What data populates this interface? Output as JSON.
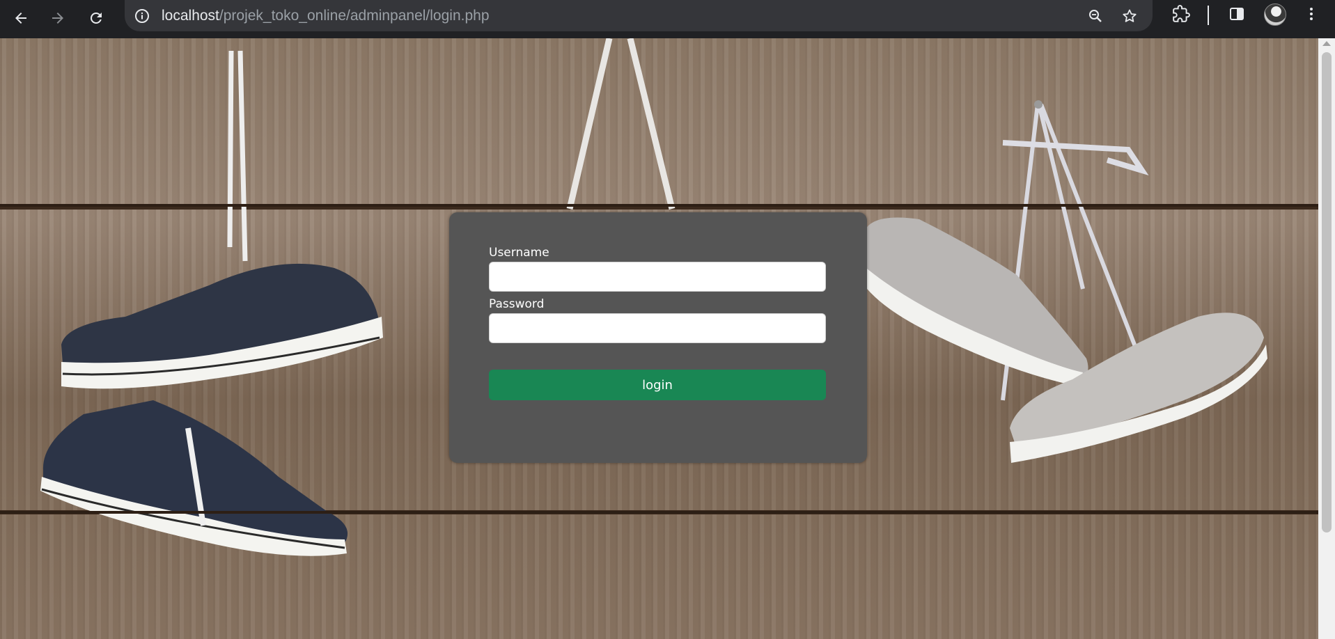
{
  "browser": {
    "url_host": "localhost",
    "url_path": "/projek_toko_online/adminpanel/login.php",
    "icons": [
      "back-arrow-icon",
      "forward-arrow-icon",
      "reload-icon",
      "site-info-icon",
      "zoom-icon",
      "bookmark-star-icon",
      "extensions-icon",
      "side-panel-icon",
      "profile-avatar",
      "more-menu-icon"
    ]
  },
  "login": {
    "username_label": "Username",
    "username_value": "",
    "password_label": "Password",
    "password_value": "",
    "button_label": "login"
  },
  "colors": {
    "card_background": "#555555",
    "button_background": "#198754",
    "chrome_background": "#202124",
    "omnibox_background": "#35363a"
  }
}
